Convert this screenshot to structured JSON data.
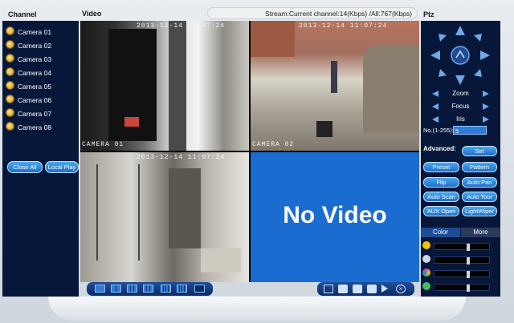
{
  "header": {
    "channel_title": "Channel",
    "video_title": "Video",
    "ptz_title": "Ptz",
    "stream_info": "Stream:Current channel:14(Kbps) /All:767(Kbps)"
  },
  "channels": [
    {
      "label": "Camera 01"
    },
    {
      "label": "Camera 02"
    },
    {
      "label": "Camera 03"
    },
    {
      "label": "Camera 04"
    },
    {
      "label": "Camera 05"
    },
    {
      "label": "Camera 06"
    },
    {
      "label": "Camera 07"
    },
    {
      "label": "Camera 08"
    }
  ],
  "left_buttons": {
    "close_all": "Close All",
    "local_play": "Local Play"
  },
  "video": {
    "tiles": [
      {
        "timestamp": "2013-12-14 11:07:24",
        "label": "CAMERA 01"
      },
      {
        "timestamp": "2013-12-14 11:07:24",
        "label": "CAMERA 02"
      },
      {
        "timestamp": "2013-12-14 11:07:24",
        "label": ""
      }
    ],
    "no_video": "No Video"
  },
  "ptz": {
    "zoom": "Zoom",
    "focus": "Focus",
    "iris": "Iris",
    "preset_no_label": "No.(1-255):",
    "preset_no_value": "5",
    "advanced_label": "Advanced:",
    "buttons": {
      "set": "Set",
      "preset": "Preset",
      "pattern": "Pattern",
      "flip": "Flip",
      "auto_pan": "Auto Pan",
      "auto_scan": "Auto Scan",
      "auto_tour": "Auto Tour",
      "aux_open": "AUX Open",
      "light_wiper": "LightWiper"
    },
    "tabs": {
      "color": "Color",
      "more": "More"
    },
    "sliders": [
      {
        "icon": "brightness-icon",
        "color": "#f2c200",
        "level": 0.6
      },
      {
        "icon": "contrast-icon",
        "color": "#cfd6e0",
        "level": 0.6
      },
      {
        "icon": "hue-icon",
        "color": "#e04ab0",
        "level": 0.6
      },
      {
        "icon": "saturation-icon",
        "color": "#3fc060",
        "level": 0.6
      }
    ]
  },
  "colors": {
    "panel": "#07173a",
    "accent": "#1e6fc8",
    "no_video": "#1a6cd0"
  }
}
